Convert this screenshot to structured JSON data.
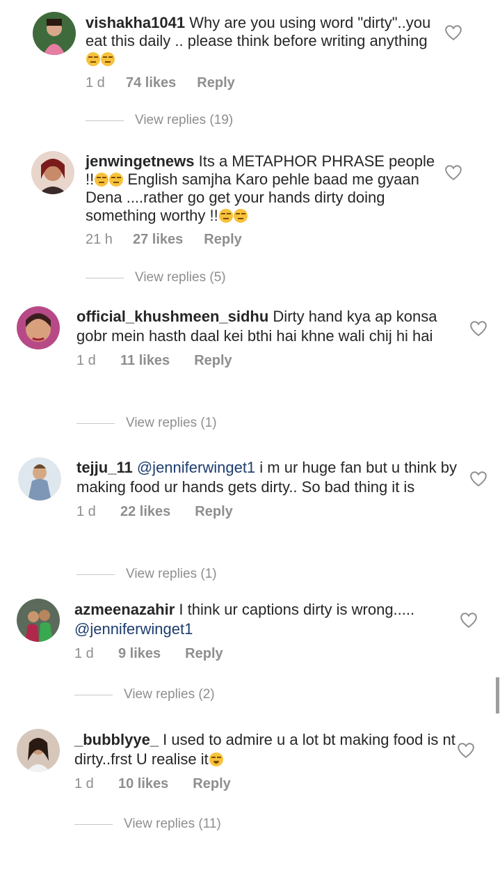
{
  "comments": [
    {
      "username": "vishakha1041",
      "text": "Why are you using word \"dirty\"..you eat this daily .. please think before writing anything",
      "emojis": "😑😑",
      "time": "1 d",
      "likes": "74 likes",
      "reply": "Reply",
      "view_replies": "View replies (19)"
    },
    {
      "username": "jenwingetnews",
      "text": "Its a METAPHOR PHRASE people !!",
      "text2": "English samjha Karo pehle baad me gyaan Dena ....rather go get your hands dirty doing something worthy !!",
      "time": "21 h",
      "likes": "27 likes",
      "reply": "Reply",
      "view_replies": "View replies (5)"
    },
    {
      "username": "official_khushmeen_sidhu",
      "text": "Dirty hand kya ap konsa gobr mein hasth daal kei bthi hai khne wali chij hi hai",
      "time": "1 d",
      "likes": "11 likes",
      "reply": "Reply",
      "view_replies": "View replies (1)"
    },
    {
      "username": "tejju_11",
      "mention": "@jenniferwinget1",
      "text": "i m ur huge fan but u think by making food ur hands gets dirty.. So bad thing it is",
      "time": "1 d",
      "likes": "22 likes",
      "reply": "Reply",
      "view_replies": "View replies (1)"
    },
    {
      "username": "azmeenazahir",
      "text": "I think ur captions dirty is wrong.....",
      "mention": "@jenniferwinget1",
      "time": "1 d",
      "likes": "9 likes",
      "reply": "Reply",
      "view_replies": "View replies (2)"
    },
    {
      "username": "_bubblyye_",
      "text": "I used to admire u a lot bt making food is nt dirty..frst U realise it",
      "time": "1 d",
      "likes": "10 likes",
      "reply": "Reply",
      "view_replies": "View replies (11)"
    }
  ],
  "icons": {
    "like": "heart-outline-icon"
  }
}
